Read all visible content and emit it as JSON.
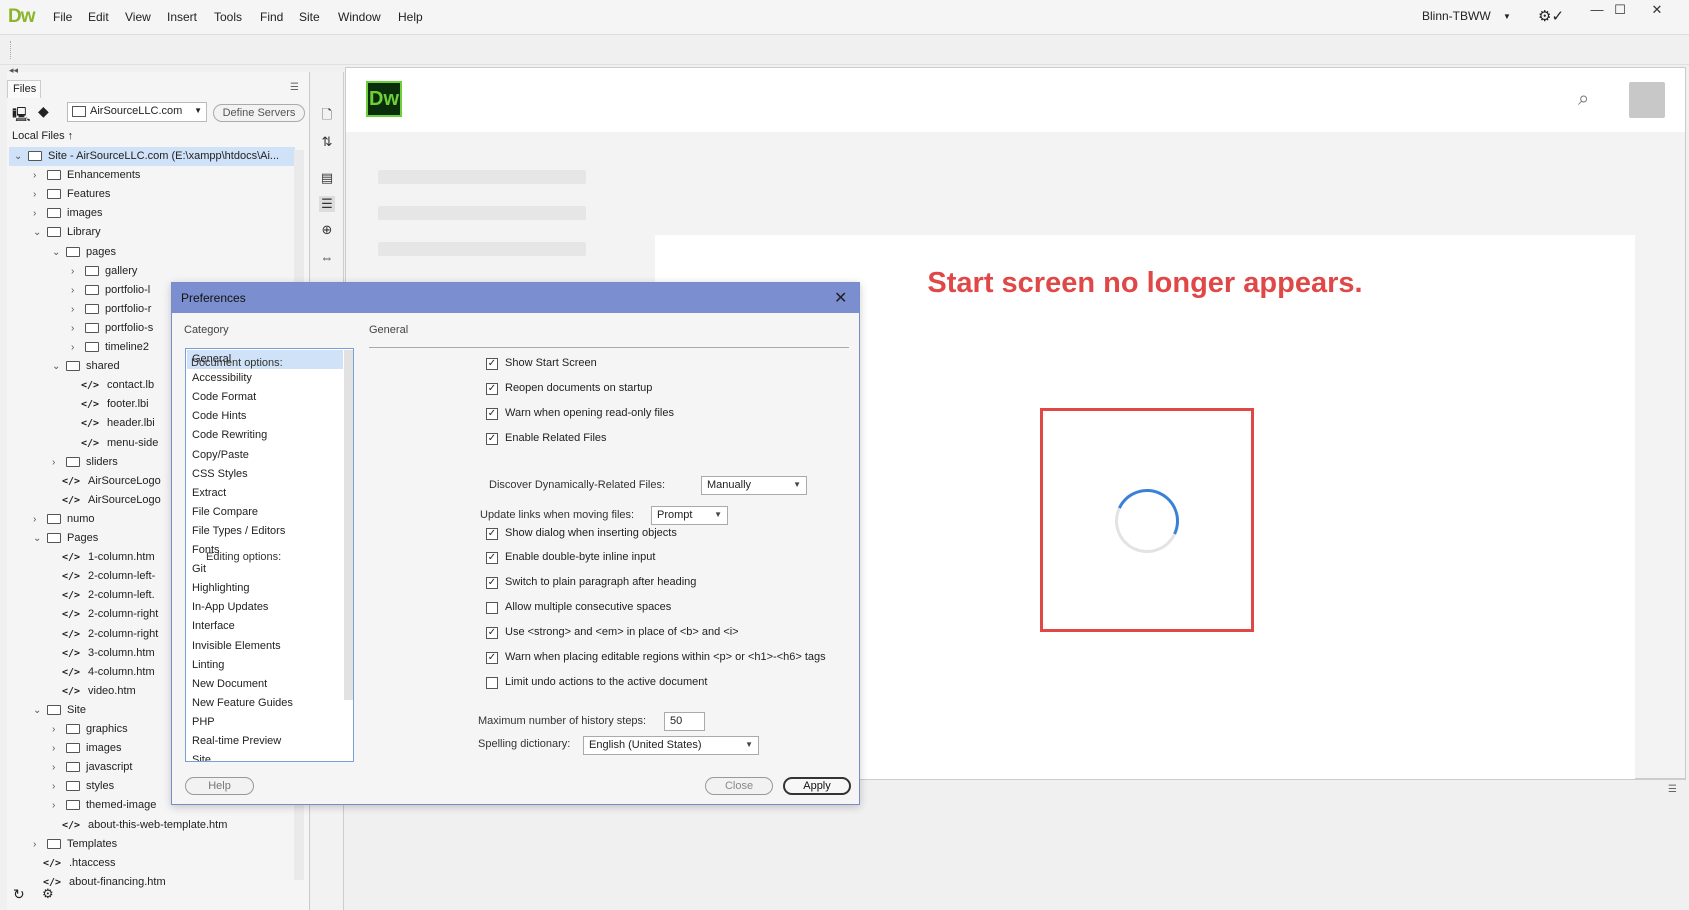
{
  "app": {
    "logo": "Dw"
  },
  "menu": [
    "File",
    "Edit",
    "View",
    "Insert",
    "Tools",
    "Find",
    "Site",
    "Window",
    "Help"
  ],
  "workspace": "Blinn-TBWW",
  "window_controls": {
    "minimize": "—",
    "maximize": "☐",
    "close": "✕"
  },
  "files_panel": {
    "tab": "Files",
    "site_select": "AirSourceLLC.com",
    "define_servers": "Define Servers",
    "local_files": "Local Files ↑",
    "tree": [
      {
        "label": "Site - AirSourceLLC.com (E:\\xampp\\htdocs\\Ai...",
        "kind": "folder",
        "level": 0,
        "chev": "⌄",
        "selected": true
      },
      {
        "label": "Enhancements",
        "kind": "folder",
        "level": 1,
        "chev": "›"
      },
      {
        "label": "Features",
        "kind": "folder",
        "level": 1,
        "chev": "›"
      },
      {
        "label": "images",
        "kind": "folder",
        "level": 1,
        "chev": "›"
      },
      {
        "label": "Library",
        "kind": "folder",
        "level": 1,
        "chev": "⌄"
      },
      {
        "label": "pages",
        "kind": "folder",
        "level": 2,
        "chev": "⌄"
      },
      {
        "label": "gallery",
        "kind": "folder",
        "level": 3,
        "chev": "›"
      },
      {
        "label": "portfolio-l",
        "kind": "folder",
        "level": 3,
        "chev": "›"
      },
      {
        "label": "portfolio-r",
        "kind": "folder",
        "level": 3,
        "chev": "›"
      },
      {
        "label": "portfolio-s",
        "kind": "folder",
        "level": 3,
        "chev": "›"
      },
      {
        "label": "timeline2",
        "kind": "folder",
        "level": 3,
        "chev": "›"
      },
      {
        "label": "shared",
        "kind": "folder",
        "level": 2,
        "chev": "⌄"
      },
      {
        "label": "contact.lb",
        "kind": "file",
        "level": 3
      },
      {
        "label": "footer.lbi",
        "kind": "file",
        "level": 3
      },
      {
        "label": "header.lbi",
        "kind": "file",
        "level": 3
      },
      {
        "label": "menu-side",
        "kind": "file",
        "level": 3
      },
      {
        "label": "sliders",
        "kind": "folder",
        "level": 2,
        "chev": "›"
      },
      {
        "label": "AirSourceLogo",
        "kind": "file",
        "level": 2
      },
      {
        "label": "AirSourceLogo",
        "kind": "file",
        "level": 2
      },
      {
        "label": "numo",
        "kind": "folder",
        "level": 1,
        "chev": "›"
      },
      {
        "label": "Pages",
        "kind": "folder",
        "level": 1,
        "chev": "⌄"
      },
      {
        "label": "1-column.htm",
        "kind": "file",
        "level": 2
      },
      {
        "label": "2-column-left-",
        "kind": "file",
        "level": 2
      },
      {
        "label": "2-column-left.",
        "kind": "file",
        "level": 2
      },
      {
        "label": "2-column-right",
        "kind": "file",
        "level": 2
      },
      {
        "label": "2-column-right",
        "kind": "file",
        "level": 2
      },
      {
        "label": "3-column.htm",
        "kind": "file",
        "level": 2
      },
      {
        "label": "4-column.htm",
        "kind": "file",
        "level": 2
      },
      {
        "label": "video.htm",
        "kind": "file",
        "level": 2
      },
      {
        "label": "Site",
        "kind": "folder",
        "level": 1,
        "chev": "⌄"
      },
      {
        "label": "graphics",
        "kind": "folder",
        "level": 2,
        "chev": "›"
      },
      {
        "label": "images",
        "kind": "folder",
        "level": 2,
        "chev": "›"
      },
      {
        "label": "javascript",
        "kind": "folder",
        "level": 2,
        "chev": "›"
      },
      {
        "label": "styles",
        "kind": "folder",
        "level": 2,
        "chev": "›"
      },
      {
        "label": "themed-image",
        "kind": "folder",
        "level": 2,
        "chev": "›"
      },
      {
        "label": "about-this-web-template.htm",
        "kind": "file",
        "level": 2
      },
      {
        "label": "Templates",
        "kind": "folder",
        "level": 1,
        "chev": "›"
      },
      {
        "label": ".htaccess",
        "kind": "file",
        "level": 1
      },
      {
        "label": "about-financing.htm",
        "kind": "file",
        "level": 1
      }
    ]
  },
  "document": {
    "logo": "Dw",
    "headline": "Start screen no longer appears.",
    "accent_color": "#e04848"
  },
  "preferences": {
    "title": "Preferences",
    "category_label": "Category",
    "categories": [
      "General",
      "Accessibility",
      "Code Format",
      "Code Hints",
      "Code Rewriting",
      "Copy/Paste",
      "CSS Styles",
      "Extract",
      "File Compare",
      "File Types / Editors",
      "Fonts",
      "Git",
      "Highlighting",
      "In-App Updates",
      "Interface",
      "Invisible Elements",
      "Linting",
      "New Document",
      "New Feature Guides",
      "PHP",
      "Real-time Preview",
      "Site"
    ],
    "selected_category": "General",
    "section_title": "General",
    "document_options_label": "Document options:",
    "editing_options_label": "Editing options:",
    "document_options": [
      {
        "label": "Show Start Screen",
        "checked": true
      },
      {
        "label": "Reopen documents on startup",
        "checked": true
      },
      {
        "label": "Warn when opening read-only files",
        "checked": true
      },
      {
        "label": "Enable Related Files",
        "checked": true
      }
    ],
    "discover_label": "Discover Dynamically-Related Files:",
    "discover_value": "Manually",
    "update_links_label": "Update links when moving files:",
    "update_links_value": "Prompt",
    "show_dialog": {
      "label": "Show dialog when inserting objects",
      "checked": true
    },
    "editing_options": [
      {
        "label": "Enable double-byte inline input",
        "checked": true
      },
      {
        "label": "Switch to plain paragraph after heading",
        "checked": true
      },
      {
        "label": "Allow multiple consecutive spaces",
        "checked": false
      },
      {
        "label": "Use <strong> and <em> in place of <b> and <i>",
        "checked": true
      },
      {
        "label": "Warn when placing editable regions within <p> or <h1>-<h6> tags",
        "checked": true
      },
      {
        "label": "Limit undo actions to the active document",
        "checked": false
      }
    ],
    "max_history_label": "Maximum number of history steps:",
    "max_history_value": "50",
    "spelling_label": "Spelling dictionary:",
    "spelling_value": "English (United States)",
    "help_button": "Help",
    "close_button": "Close",
    "apply_button": "Apply"
  }
}
